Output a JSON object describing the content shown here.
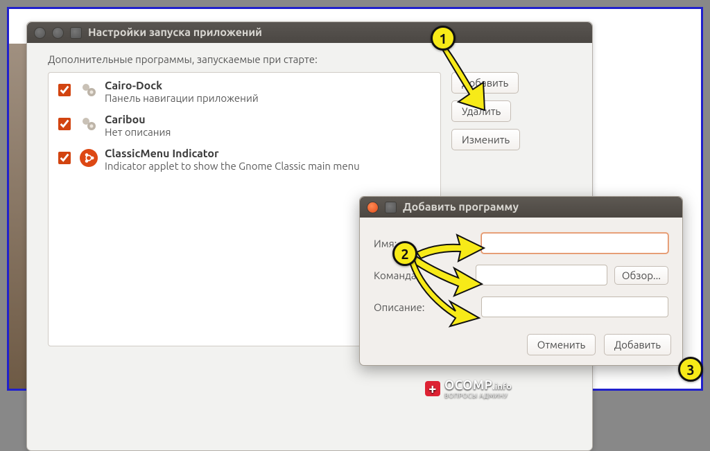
{
  "main_window": {
    "title": "Настройки запуска приложений",
    "section_label": "Дополнительные программы, запускаемые при старте:",
    "items": [
      {
        "name": "Cairo-Dock",
        "desc": "Панель навигации приложений",
        "checked": true,
        "icon": "gears"
      },
      {
        "name": "Caribou",
        "desc": "Нет описания",
        "checked": true,
        "icon": "gears"
      },
      {
        "name": "ClassicMenu Indicator",
        "desc": "Indicator applet to show the Gnome Classic main menu",
        "checked": true,
        "icon": "ubuntu"
      }
    ],
    "buttons": {
      "add": "Добавить",
      "remove": "Удалить",
      "edit": "Изменить"
    }
  },
  "dialog": {
    "title": "Добавить программу",
    "fields": {
      "name_label": "Имя:",
      "command_label": "Команда:",
      "desc_label": "Описание:",
      "name_value": "",
      "command_value": "",
      "desc_value": ""
    },
    "buttons": {
      "browse": "Обзор...",
      "cancel": "Отменить",
      "add": "Добавить"
    }
  },
  "markers": {
    "one": "1",
    "two": "2",
    "three": "3"
  },
  "watermark": {
    "brand": "OCOMP",
    "tld": ".info",
    "tagline": "ВОПРОСЫ АДМИНУ"
  }
}
